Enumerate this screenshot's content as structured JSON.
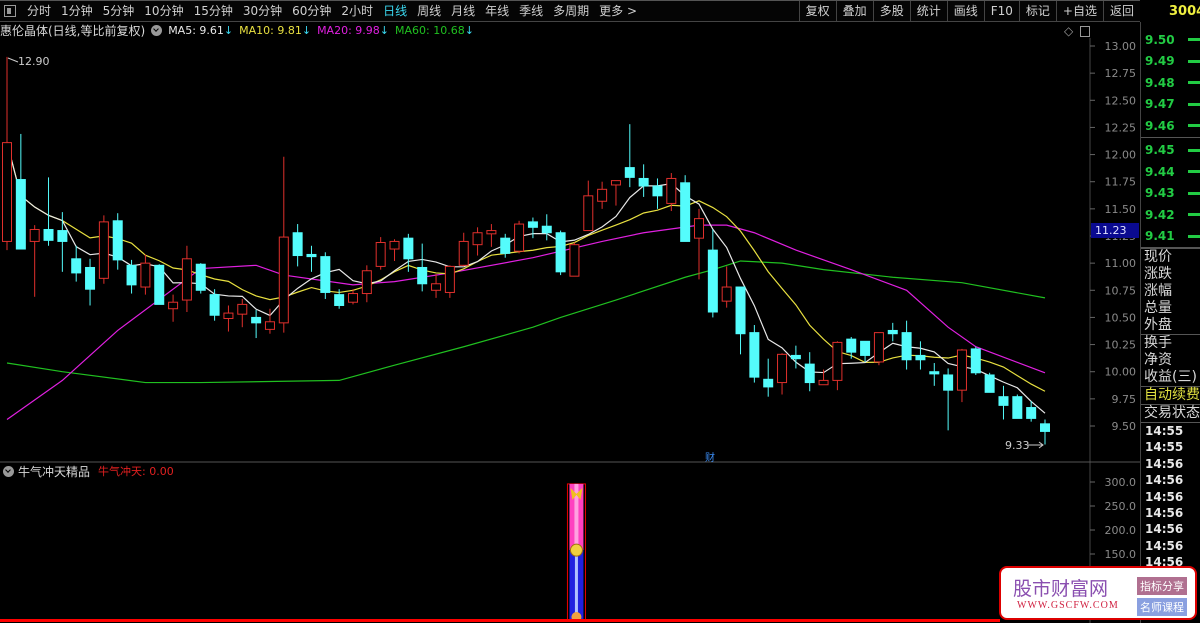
{
  "toolbar": {
    "periods": [
      "分时",
      "1分钟",
      "5分钟",
      "10分钟",
      "15分钟",
      "30分钟",
      "60分钟",
      "2小时",
      "日线",
      "周线",
      "月线",
      "年线",
      "季线",
      "多周期",
      "更多 >"
    ],
    "active": "日线",
    "actions": [
      "复权",
      "叠加",
      "多股",
      "统计",
      "画线",
      "F10",
      "标记",
      "+自选",
      "返回"
    ]
  },
  "info": {
    "stock": "惠伦晶体(日线,等比前复权)",
    "ma5": "MA5: 9.61",
    "ma10": "MA10: 9.81",
    "ma20": "MA20: 9.98",
    "ma60": "MA60: 10.68",
    "arrow": "↓"
  },
  "colors": {
    "up": "#e0302c",
    "down": "#54fcfc",
    "ma5": "#e8e8e8",
    "ma10": "#e8e040",
    "ma20": "#e020e0",
    "ma60": "#20c020"
  },
  "chart_data": {
    "type": "candlestick",
    "ylim": [
      9.3,
      13.1
    ],
    "yticks": [
      "13.00",
      "12.75",
      "12.50",
      "12.25",
      "12.00",
      "11.75",
      "11.50",
      "11.25",
      "11.00",
      "10.75",
      "10.50",
      "10.25",
      "10.00",
      "9.75",
      "9.50"
    ],
    "high_label": "12.90",
    "low_label": "9.33",
    "cursor_price": "11.23",
    "marker": "财",
    "ohlc": [
      [
        11.2,
        12.9,
        11.12,
        12.11
      ],
      [
        11.77,
        12.19,
        11.13,
        11.13
      ],
      [
        11.2,
        11.35,
        10.69,
        11.31
      ],
      [
        11.31,
        11.79,
        11.16,
        11.21
      ],
      [
        11.3,
        11.47,
        10.92,
        11.2
      ],
      [
        11.04,
        11.16,
        10.83,
        10.91
      ],
      [
        10.96,
        11.04,
        10.61,
        10.76
      ],
      [
        10.86,
        11.44,
        10.81,
        11.38
      ],
      [
        11.39,
        11.46,
        10.94,
        11.03
      ],
      [
        10.98,
        11.03,
        10.72,
        10.8
      ],
      [
        10.78,
        11.08,
        10.71,
        11.0
      ],
      [
        10.98,
        10.99,
        10.62,
        10.62
      ],
      [
        10.58,
        10.71,
        10.46,
        10.64
      ],
      [
        10.66,
        11.16,
        10.55,
        11.04
      ],
      [
        10.99,
        11.0,
        10.72,
        10.75
      ],
      [
        10.71,
        10.76,
        10.47,
        10.52
      ],
      [
        10.49,
        10.61,
        10.37,
        10.54
      ],
      [
        10.53,
        10.67,
        10.41,
        10.62
      ],
      [
        10.5,
        10.57,
        10.31,
        10.45
      ],
      [
        10.39,
        10.58,
        10.35,
        10.46
      ],
      [
        10.45,
        11.98,
        10.36,
        11.24
      ],
      [
        11.28,
        11.36,
        10.97,
        11.07
      ],
      [
        11.08,
        11.16,
        10.92,
        11.06
      ],
      [
        11.06,
        11.1,
        10.67,
        10.73
      ],
      [
        10.71,
        10.76,
        10.58,
        10.61
      ],
      [
        10.64,
        10.76,
        10.62,
        10.72
      ],
      [
        10.72,
        10.98,
        10.64,
        10.93
      ],
      [
        10.97,
        11.24,
        10.94,
        11.19
      ],
      [
        11.13,
        11.22,
        11.02,
        11.2
      ],
      [
        11.23,
        11.27,
        10.92,
        11.04
      ],
      [
        10.96,
        11.18,
        10.74,
        10.81
      ],
      [
        10.75,
        10.9,
        10.68,
        10.81
      ],
      [
        10.73,
        10.98,
        10.68,
        10.97
      ],
      [
        10.98,
        11.28,
        10.97,
        11.2
      ],
      [
        11.17,
        11.33,
        11.07,
        11.28
      ],
      [
        11.27,
        11.36,
        11.15,
        11.3
      ],
      [
        11.23,
        11.27,
        11.05,
        11.09
      ],
      [
        11.11,
        11.39,
        11.09,
        11.36
      ],
      [
        11.38,
        11.42,
        11.23,
        11.33
      ],
      [
        11.34,
        11.45,
        11.21,
        11.28
      ],
      [
        11.28,
        11.3,
        10.89,
        10.92
      ],
      [
        10.88,
        11.19,
        10.88,
        11.17
      ],
      [
        11.3,
        11.76,
        11.3,
        11.62
      ],
      [
        11.57,
        11.75,
        11.5,
        11.68
      ],
      [
        11.72,
        11.76,
        11.53,
        11.76
      ],
      [
        11.88,
        12.28,
        11.7,
        11.79
      ],
      [
        11.78,
        11.91,
        11.61,
        11.71
      ],
      [
        11.71,
        11.78,
        11.5,
        11.62
      ],
      [
        11.55,
        11.83,
        11.48,
        11.78
      ],
      [
        11.74,
        11.81,
        11.2,
        11.2
      ],
      [
        11.23,
        11.5,
        10.85,
        11.41
      ],
      [
        11.12,
        11.31,
        10.5,
        10.55
      ],
      [
        10.65,
        10.97,
        10.59,
        10.78
      ],
      [
        10.78,
        10.78,
        10.16,
        10.35
      ],
      [
        10.36,
        10.43,
        9.9,
        9.95
      ],
      [
        9.93,
        10.12,
        9.77,
        9.86
      ],
      [
        9.9,
        10.17,
        9.79,
        10.16
      ],
      [
        10.15,
        10.24,
        10.03,
        10.12
      ],
      [
        10.07,
        10.18,
        9.82,
        9.9
      ],
      [
        9.88,
        10.02,
        9.88,
        9.92
      ],
      [
        9.92,
        10.28,
        9.83,
        10.27
      ],
      [
        10.3,
        10.32,
        10.12,
        10.18
      ],
      [
        10.28,
        10.28,
        10.09,
        10.15
      ],
      [
        10.09,
        10.36,
        10.06,
        10.36
      ],
      [
        10.38,
        10.45,
        10.28,
        10.35
      ],
      [
        10.36,
        10.47,
        10.02,
        10.11
      ],
      [
        10.15,
        10.28,
        10.02,
        10.11
      ],
      [
        10.0,
        10.08,
        9.87,
        9.98
      ],
      [
        9.97,
        10.03,
        9.46,
        9.83
      ],
      [
        9.83,
        10.21,
        9.72,
        10.2
      ],
      [
        10.21,
        10.23,
        9.97,
        9.99
      ],
      [
        9.97,
        9.99,
        9.81,
        9.81
      ],
      [
        9.77,
        9.87,
        9.56,
        9.69
      ],
      [
        9.77,
        9.79,
        9.57,
        9.57
      ],
      [
        9.67,
        9.73,
        9.54,
        9.57
      ],
      [
        9.52,
        9.56,
        9.33,
        9.45
      ]
    ],
    "ma20": [
      [
        0,
        9.56
      ],
      [
        4,
        9.92
      ],
      [
        8,
        10.38
      ],
      [
        14,
        10.95
      ],
      [
        18,
        10.98
      ],
      [
        20,
        10.89
      ],
      [
        25,
        10.8
      ],
      [
        28,
        10.83
      ],
      [
        32,
        10.91
      ],
      [
        38,
        11.05
      ],
      [
        43,
        11.2
      ],
      [
        46,
        11.28
      ],
      [
        50,
        11.35
      ],
      [
        52,
        11.35
      ],
      [
        54,
        11.28
      ],
      [
        57,
        11.12
      ],
      [
        61,
        10.94
      ],
      [
        65,
        10.75
      ],
      [
        68,
        10.41
      ],
      [
        70,
        10.23
      ],
      [
        75,
        9.99
      ]
    ],
    "ma60": [
      [
        0,
        10.08
      ],
      [
        4,
        10.0
      ],
      [
        10,
        9.9
      ],
      [
        14,
        9.9
      ],
      [
        24,
        9.92
      ],
      [
        28,
        10.06
      ],
      [
        33,
        10.23
      ],
      [
        38,
        10.41
      ],
      [
        40,
        10.5
      ],
      [
        44,
        10.66
      ],
      [
        49,
        10.87
      ],
      [
        51,
        10.94
      ],
      [
        53,
        11.02
      ],
      [
        56,
        11.0
      ],
      [
        59,
        10.94
      ],
      [
        64,
        10.87
      ],
      [
        69,
        10.82
      ],
      [
        75,
        10.68
      ]
    ]
  },
  "indicator": {
    "name": "牛气冲天精品",
    "value_label": "牛气冲天: 0.00",
    "yticks": [
      "300.0",
      "250.0",
      "200.0",
      "150.0"
    ],
    "signal_index": 41,
    "signal_top": 296,
    "signal_split": 158
  },
  "right_panel": {
    "code": "3004",
    "asks": [
      "9.50",
      "9.49",
      "9.48",
      "9.47",
      "9.46"
    ],
    "bids": [
      "9.45",
      "9.44",
      "9.43",
      "9.42",
      "9.41"
    ],
    "labels": [
      "现价",
      "涨跌",
      "涨幅",
      "总量",
      "外盘",
      "换手",
      "净资",
      "收益(三)"
    ],
    "auto_fee": "自动续费",
    "trade_status": "交易状态",
    "times": [
      "14:55",
      "14:55",
      "14:56",
      "14:56",
      "14:56",
      "14:56",
      "14:56",
      "14:56",
      "14:56",
      "14:56"
    ]
  },
  "ad": {
    "title": "股市财富网",
    "url": "WWW.GSCFW.COM",
    "btn1": "指标分享",
    "btn2": "名师课程"
  }
}
